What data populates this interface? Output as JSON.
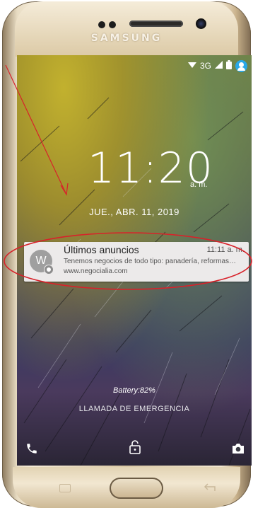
{
  "device": {
    "brand": "SAMSUNG"
  },
  "status_bar": {
    "network": "3G"
  },
  "lockscreen": {
    "time": "11:20",
    "ampm": "a. m.",
    "date": "JUE., ABR. 11, 2019",
    "battery_text": "Battery:82%",
    "emergency_text": "LLAMADA DE EMERGENCIA"
  },
  "notification": {
    "avatar_letter": "W",
    "title": "Últimos anuncios",
    "time": "11:11 a. m.",
    "text": "Tenemos negocios de todo tipo: panadería, reformas…",
    "url": "www.negocialia.com"
  },
  "icons": [
    "wifi-icon",
    "signal-icon",
    "battery-icon",
    "user-icon",
    "phone-icon",
    "lock-icon",
    "camera-icon"
  ],
  "colors": {
    "annotation": "#d8222a",
    "user_icon": "#29a8e8"
  }
}
